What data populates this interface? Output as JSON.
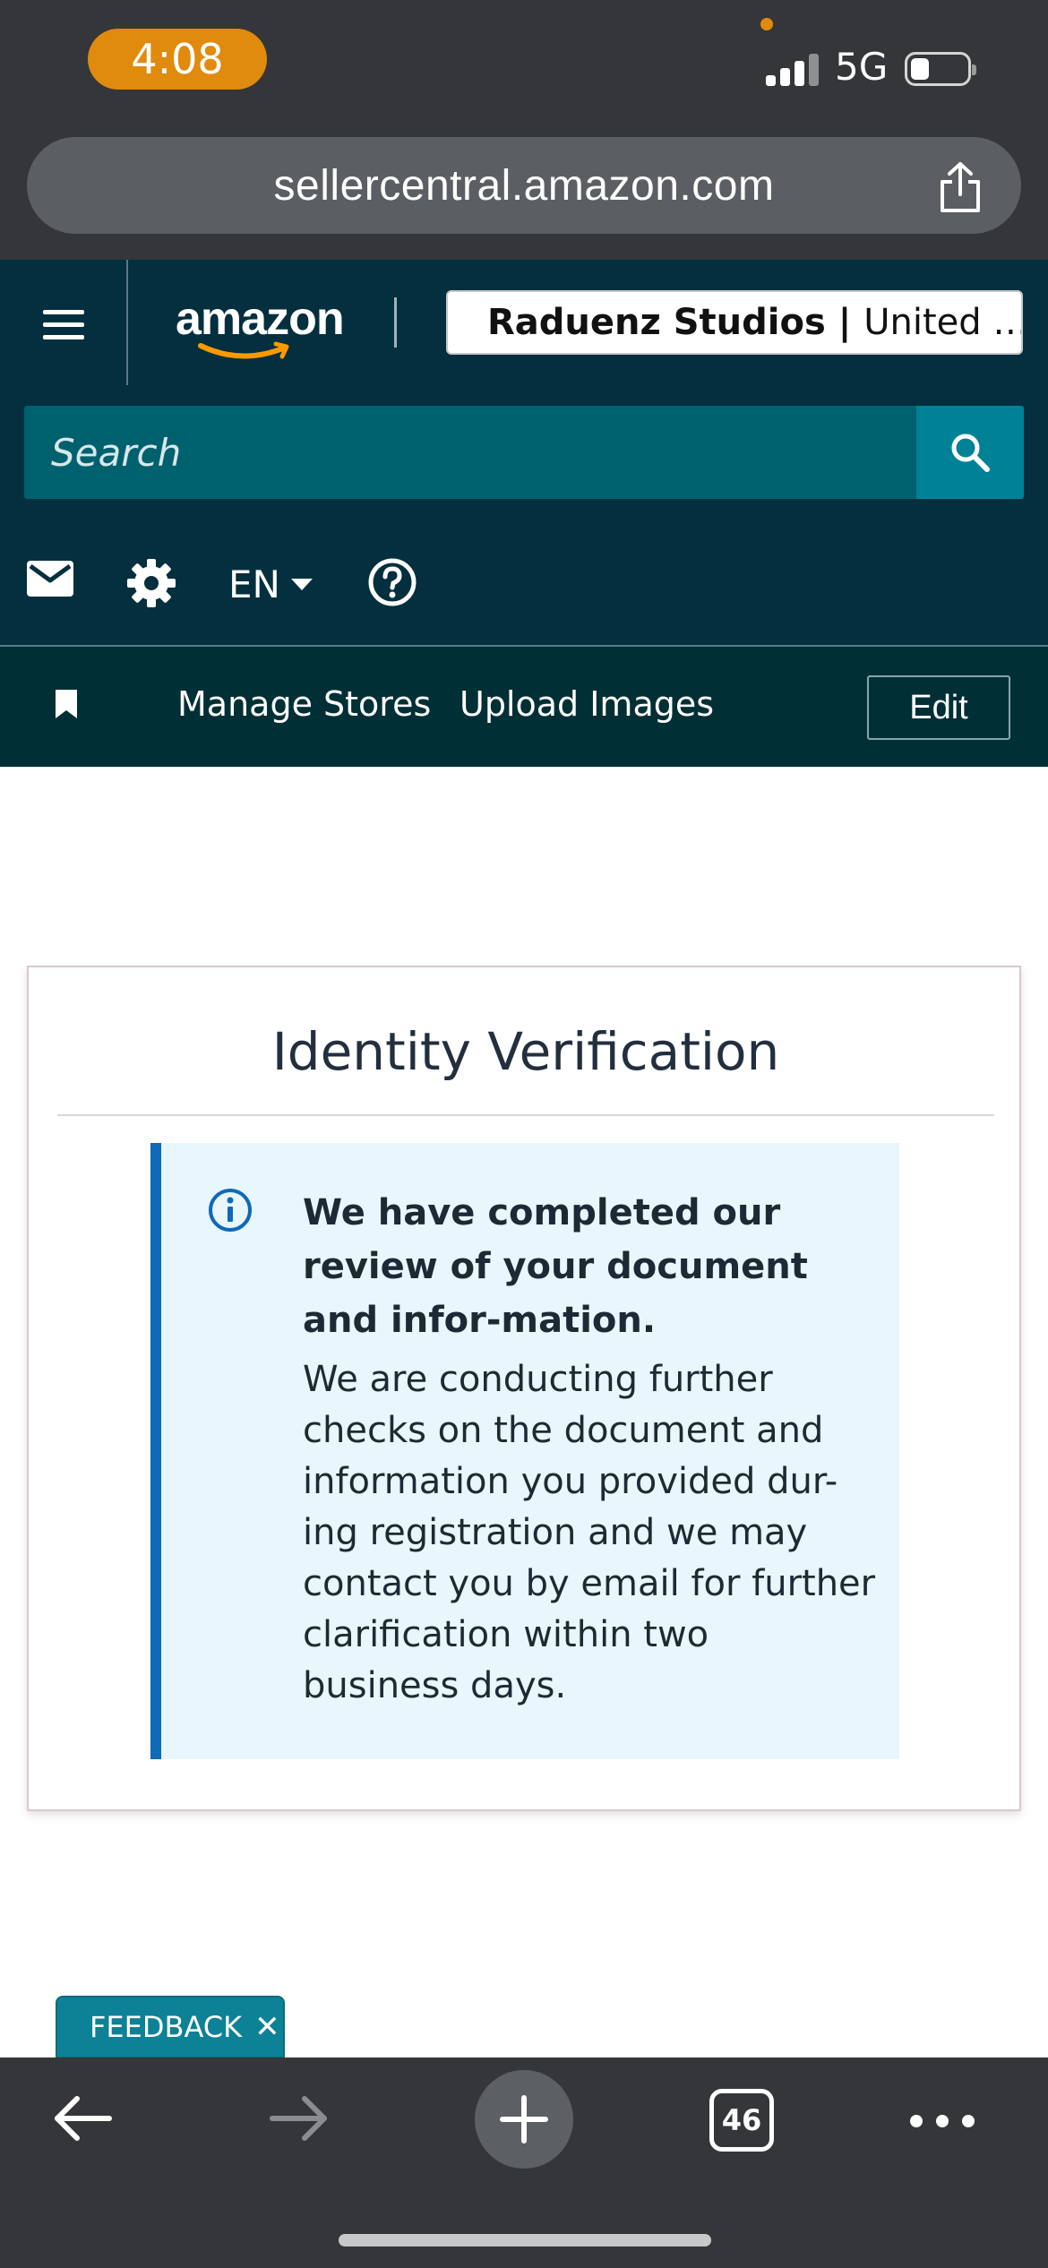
{
  "status_bar": {
    "time": "4:08",
    "network": "5G",
    "signal_icon": "cellular-signal-icon",
    "battery_icon": "battery-low-icon"
  },
  "browser": {
    "url": "sellercentral.amazon.com",
    "share_icon": "share-icon"
  },
  "header": {
    "logo_text": "amazon",
    "store_name": "Raduenz Studios",
    "store_separator": " | ",
    "store_region": "United …",
    "search_placeholder": "Search",
    "language": "EN",
    "icons": [
      "menu-icon",
      "mail-icon",
      "gear-icon",
      "help-icon",
      "search-icon",
      "bookmark-icon"
    ]
  },
  "nav": {
    "links": [
      "Manage Stores",
      "Upload Images"
    ],
    "edit_label": "Edit"
  },
  "card": {
    "title": "Identity Verification",
    "alert_heading": "We have completed our review of your document and infor-mation.",
    "alert_body": "We are conducting further checks on the document and information you provided dur-ing registration and we may contact you by email for further clarification within two business days."
  },
  "feedback": {
    "label": "FEEDBACK",
    "close_glyph": "✕"
  },
  "toolbar": {
    "tab_count": "46",
    "icons": [
      "back-arrow-icon",
      "forward-arrow-icon",
      "new-tab-plus-icon",
      "tabs-icon",
      "more-icon"
    ]
  },
  "colors": {
    "header_bg": "#032f3e",
    "search_btn": "#008296",
    "alert_accent": "#0e6ab8",
    "alert_bg": "#e8f6fd",
    "time_pill": "#e08a0e"
  }
}
